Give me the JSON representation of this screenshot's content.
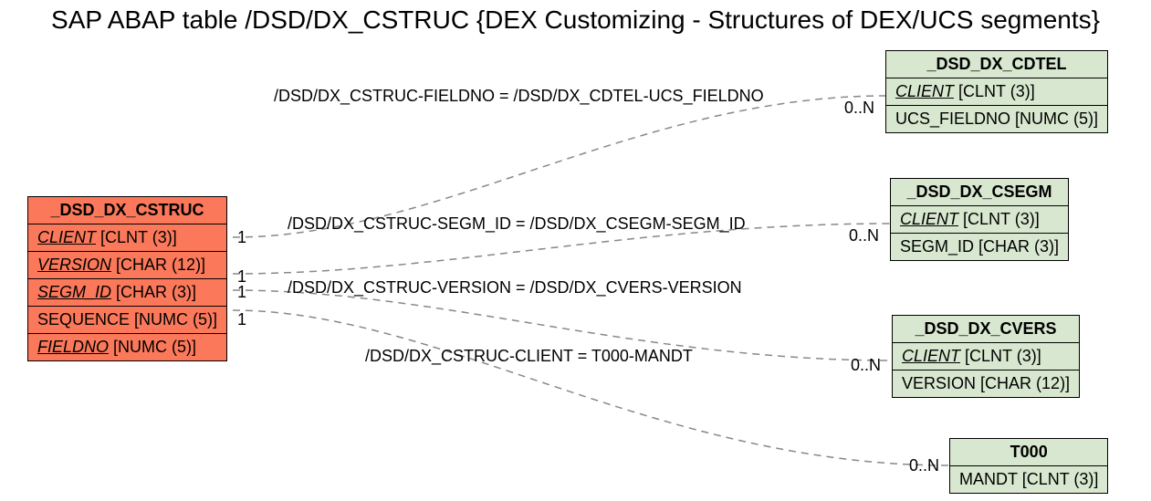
{
  "title": "SAP ABAP table /DSD/DX_CSTRUC {DEX Customizing - Structures of DEX/UCS segments}",
  "source": {
    "name": "_DSD_DX_CSTRUC",
    "fields": [
      {
        "label": "CLIENT",
        "type": "[CLNT (3)]",
        "underline": true
      },
      {
        "label": "VERSION",
        "type": "[CHAR (12)]",
        "underline": true
      },
      {
        "label": "SEGM_ID",
        "type": "[CHAR (3)]",
        "underline": true
      },
      {
        "label": "SEQUENCE",
        "type": "[NUMC (5)]",
        "underline": false
      },
      {
        "label": "FIELDNO",
        "type": "[NUMC (5)]",
        "underline": true
      }
    ]
  },
  "targets": [
    {
      "name": "_DSD_DX_CDTEL",
      "fields": [
        {
          "label": "CLIENT",
          "type": "[CLNT (3)]",
          "underline": true
        },
        {
          "label": "UCS_FIELDNO",
          "type": "[NUMC (5)]",
          "underline": false
        }
      ]
    },
    {
      "name": "_DSD_DX_CSEGM",
      "fields": [
        {
          "label": "CLIENT",
          "type": "[CLNT (3)]",
          "underline": true
        },
        {
          "label": "SEGM_ID",
          "type": "[CHAR (3)]",
          "underline": false
        }
      ]
    },
    {
      "name": "_DSD_DX_CVERS",
      "fields": [
        {
          "label": "CLIENT",
          "type": "[CLNT (3)]",
          "underline": true
        },
        {
          "label": "VERSION",
          "type": "[CHAR (12)]",
          "underline": false
        }
      ]
    },
    {
      "name": "T000",
      "fields": [
        {
          "label": "MANDT",
          "type": "[CLNT (3)]",
          "underline": false
        }
      ]
    }
  ],
  "relations": [
    {
      "label": "/DSD/DX_CSTRUC-FIELDNO = /DSD/DX_CDTEL-UCS_FIELDNO",
      "leftCard": "1",
      "rightCard": "0..N"
    },
    {
      "label": "/DSD/DX_CSTRUC-SEGM_ID = /DSD/DX_CSEGM-SEGM_ID",
      "leftCard": "1",
      "rightCard": "0..N"
    },
    {
      "label": "/DSD/DX_CSTRUC-VERSION = /DSD/DX_CVERS-VERSION",
      "leftCard": "1",
      "rightCard": "0..N"
    },
    {
      "label": "/DSD/DX_CSTRUC-CLIENT = T000-MANDT",
      "leftCard": "1",
      "rightCard": "0..N"
    }
  ]
}
